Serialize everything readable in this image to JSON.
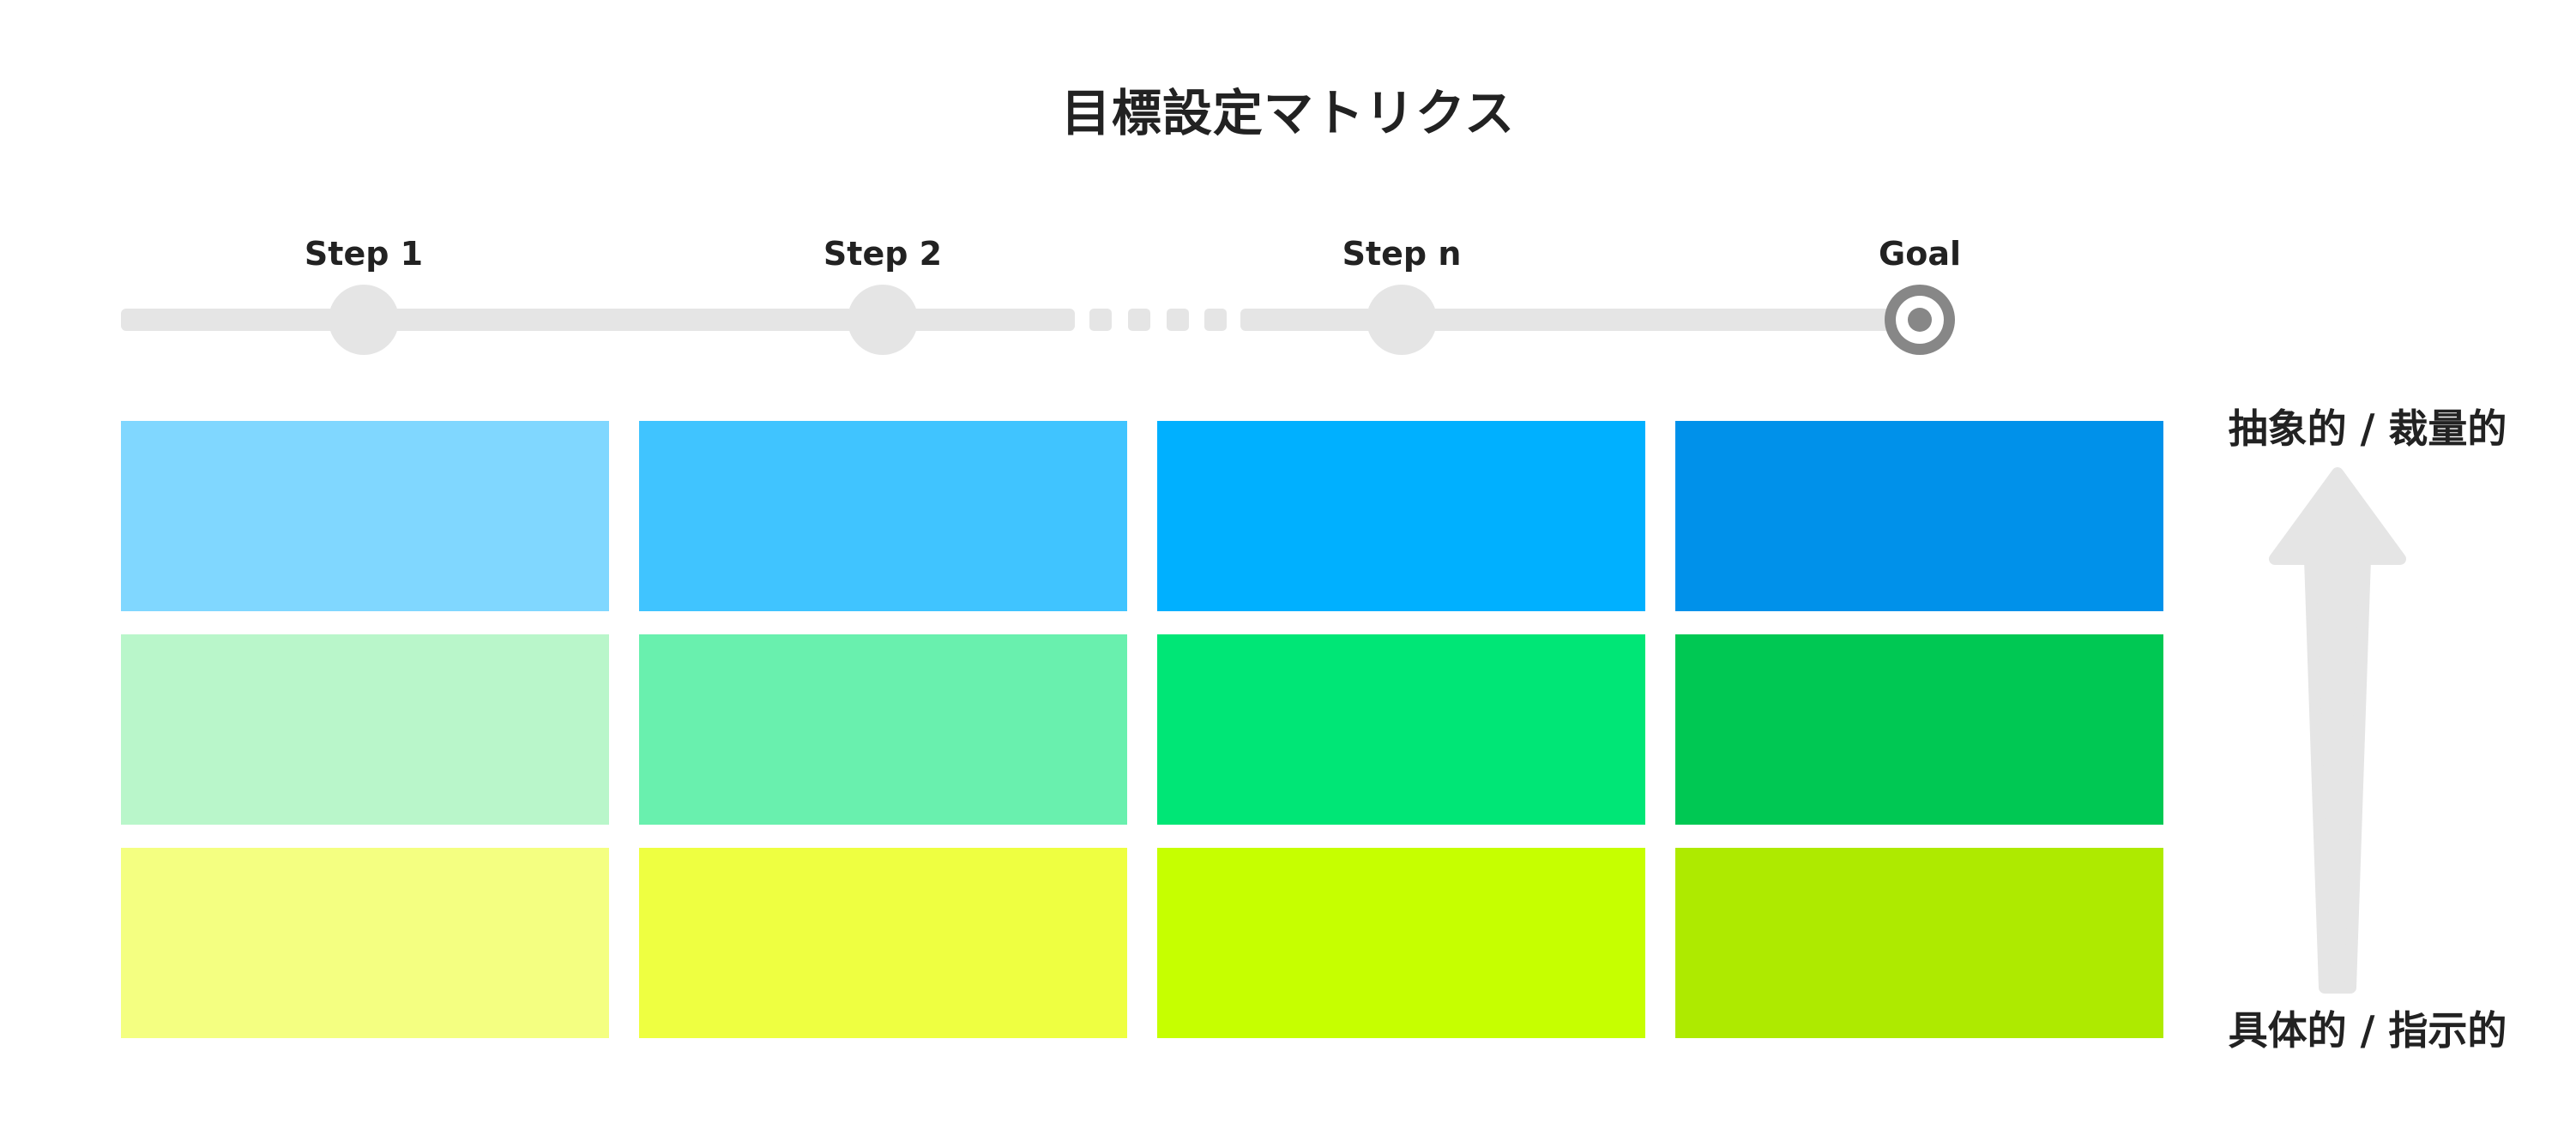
{
  "diagram": {
    "title": "目標設定マトリクス",
    "timeline": {
      "steps": [
        {
          "label": "Step 1"
        },
        {
          "label": "Step 2"
        },
        {
          "label": "Step n"
        },
        {
          "label": "Goal"
        }
      ],
      "track_color": "#e5e5e5",
      "goal_marker_color": "#878787"
    },
    "matrix": {
      "rows": [
        {
          "colors": [
            "#80d7ff",
            "#40c4ff",
            "#00b0ff",
            "#0091ea"
          ]
        },
        {
          "colors": [
            "#b9f6ca",
            "#69f0ae",
            "#00e676",
            "#00c853"
          ]
        },
        {
          "colors": [
            "#f4ff81",
            "#eeff41",
            "#c6ff00",
            "#aeea00"
          ]
        }
      ]
    },
    "axis": {
      "top_label": "抽象的 / 裁量的",
      "bottom_label": "具体的 / 指示的",
      "arrow_color": "#e5e5e5"
    }
  }
}
